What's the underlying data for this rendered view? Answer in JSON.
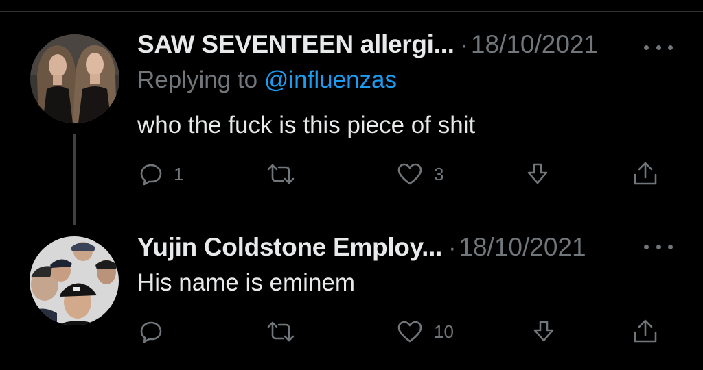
{
  "colors": {
    "background": "#000000",
    "text_primary": "#e7e9ea",
    "text_secondary": "#71767b",
    "link": "#1d9bf0",
    "thread_line": "#3e4144"
  },
  "tweets": [
    {
      "display_name": "SAW SEVENTEEN allergi...",
      "separator": "·",
      "date": "18/10/2021",
      "replying_prefix": "Replying to ",
      "replying_handle": "@influenzas",
      "text": "who the fuck is this piece of shit",
      "reply_count": "1",
      "retweet_count": "",
      "like_count": "3",
      "icons": [
        "reply-icon",
        "retweet-icon",
        "like-icon",
        "bookmark-download-icon",
        "share-icon",
        "more-icon"
      ]
    },
    {
      "display_name": "Yujin Coldstone Employ...",
      "separator": "·",
      "date": "18/10/2021",
      "text": "His name is eminem",
      "reply_count": "",
      "retweet_count": "",
      "like_count": "10",
      "icons": [
        "reply-icon",
        "retweet-icon",
        "like-icon",
        "bookmark-download-icon",
        "share-icon",
        "more-icon"
      ]
    }
  ]
}
